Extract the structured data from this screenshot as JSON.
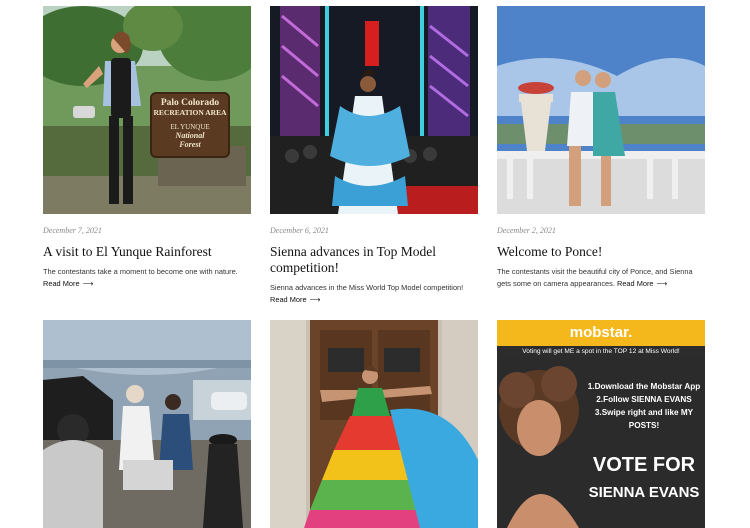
{
  "posts": [
    {
      "date": "December 7, 2021",
      "title": "A visit to El Yunque Rainforest",
      "excerpt": "The contestants take a moment to become one with nature.",
      "more": "Read More",
      "image_alt": "Woman posing in front of Palo Colorado Recreation Area sign",
      "sign": {
        "line1a": "Palo Colorado",
        "line1b": "RECREATION AREA",
        "line2": "EL YUNQUE",
        "line3a": "National",
        "line3b": "Forest"
      }
    },
    {
      "date": "December 6, 2021",
      "title": "Sienna advances in Top Model competition!",
      "excerpt": "Sienna advances in the Miss World Top Model competition!",
      "more": "Read More",
      "image_alt": "Model walking the runway in a blue and white gown"
    },
    {
      "date": "December 2, 2021",
      "title": "Welcome to Ponce!",
      "excerpt": "The contestants visit the beautiful city of Ponce, and Sienna gets some on camera appearances.",
      "more": "Read More",
      "image_alt": "Two women sitting on a balustrade overlooking a city"
    },
    {
      "image_alt": "Film crew recording under a canopy tent"
    },
    {
      "image_alt": "Woman in a colorful ruffled dress in front of a wooden door"
    },
    {
      "image_alt": "Mobstar promotional poster",
      "poster": {
        "brand": "mobstar.",
        "tagline": "Voting will get ME a spot in the TOP 12 at Miss World!",
        "step1": "1.Download the Mobstar App",
        "step2": "2.Follow SIENNA EVANS",
        "step3": "3.Swipe right and like MY POSTS!",
        "vote": "VOTE FOR",
        "name": "SIENNA EVANS"
      }
    }
  ],
  "arrow": "⟶",
  "colors": {
    "date": "#888888",
    "title": "#111111",
    "mobstar_yellow": "#f5b81c"
  }
}
